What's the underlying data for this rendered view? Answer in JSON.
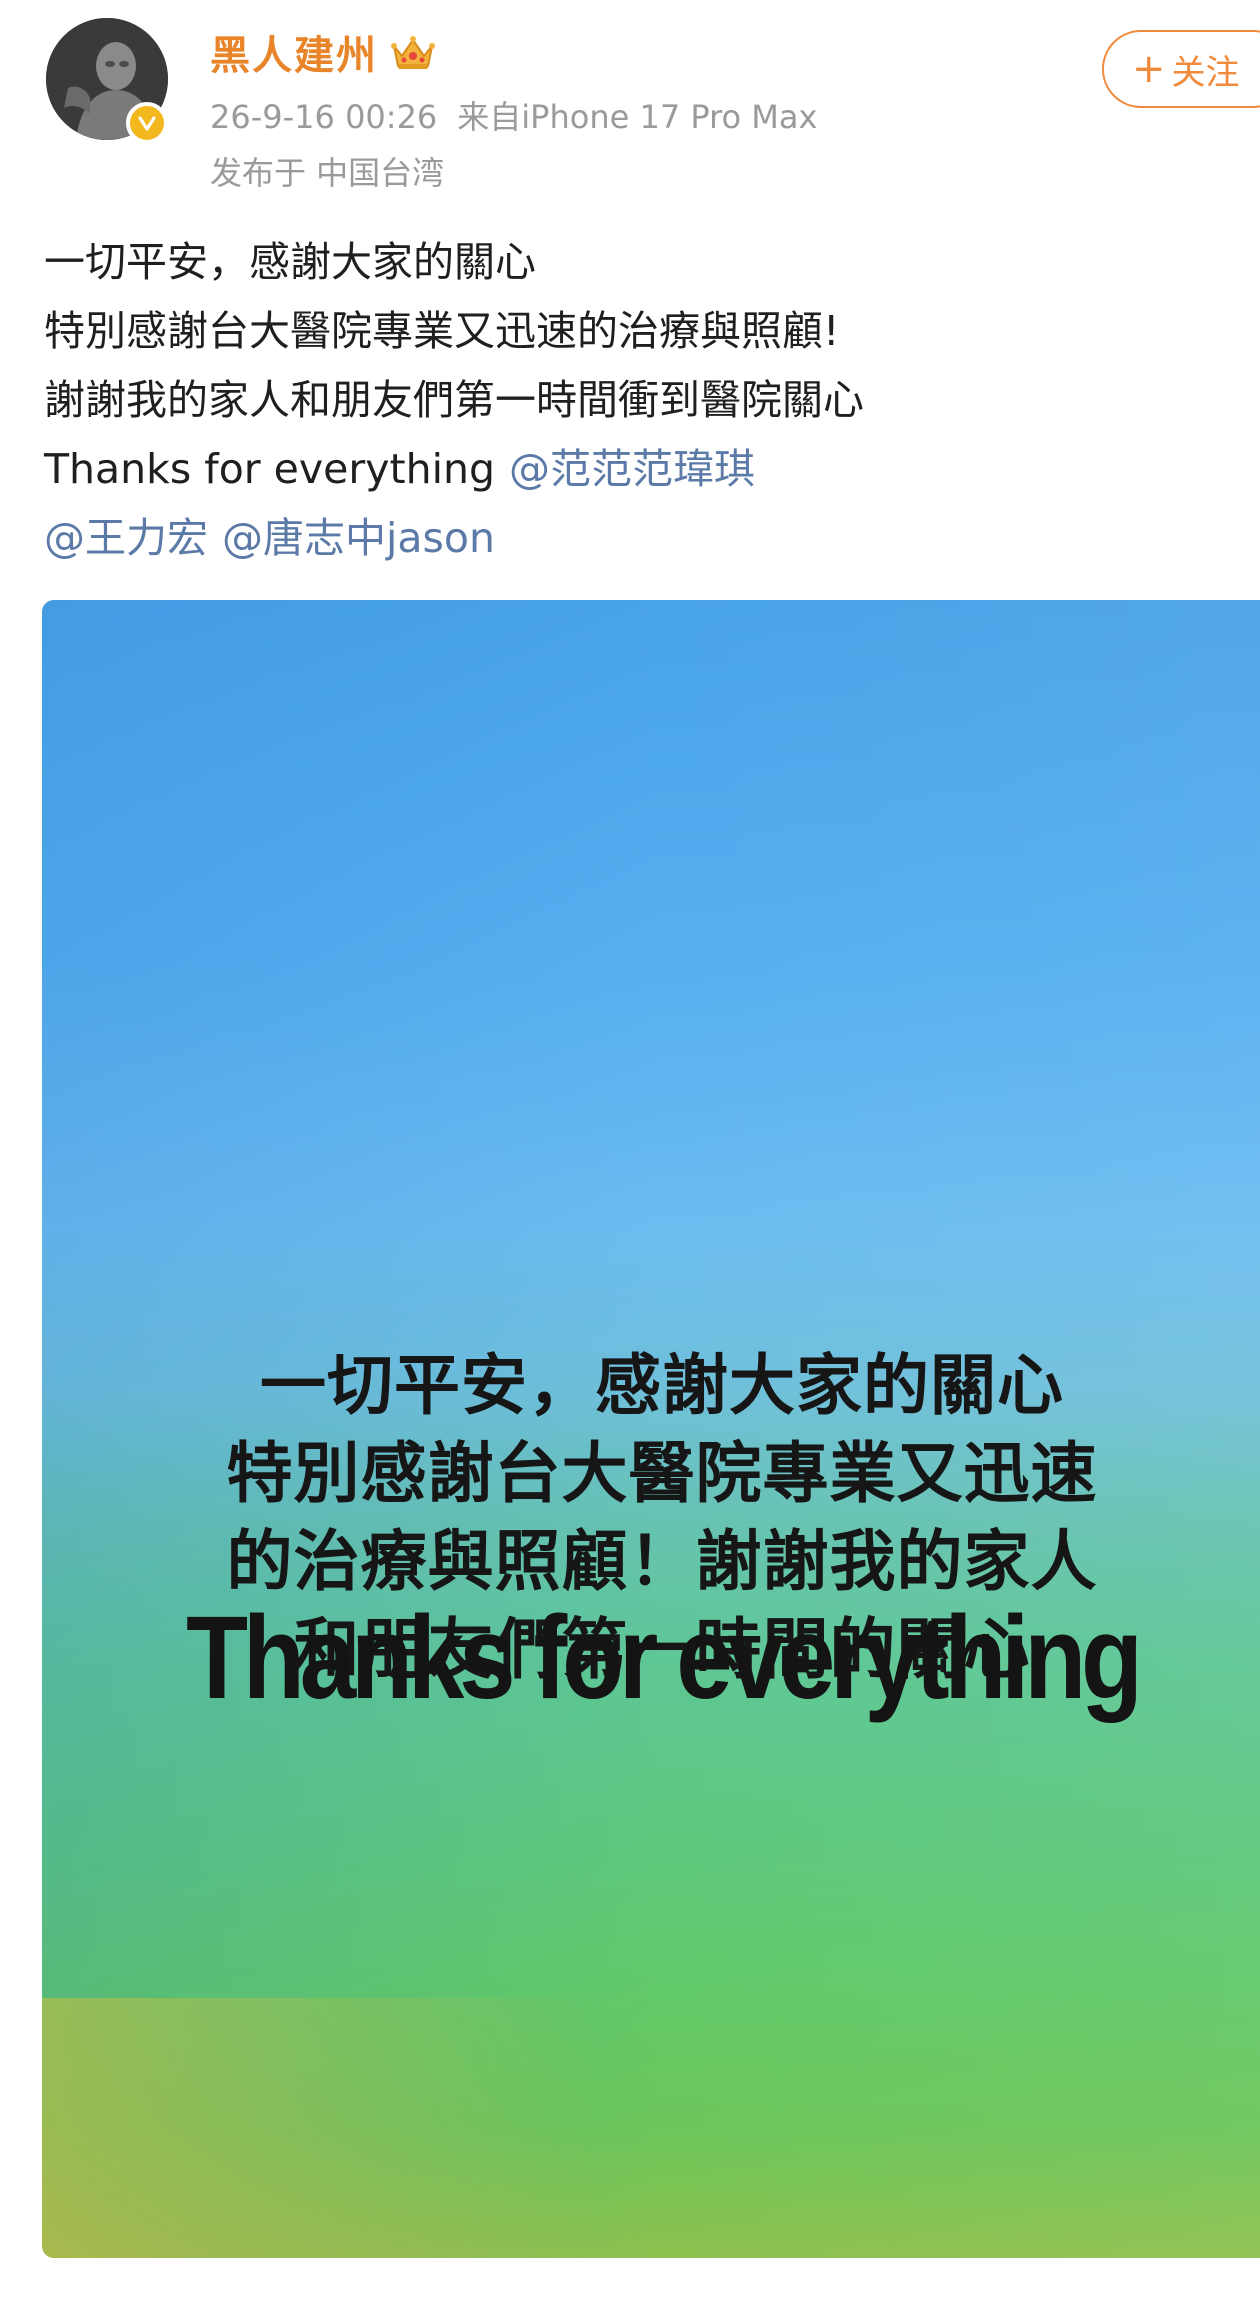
{
  "header": {
    "username": "黑人建州",
    "meta_time": "26-9-16 00:26",
    "meta_source": "来自iPhone 17 Pro Max",
    "meta_location": "发布于 中国台湾",
    "follow_plus": "+",
    "follow_label": "关注"
  },
  "post": {
    "lines": [
      "一切平安，感謝大家的關心",
      "特別感謝台大醫院專業又迅速的治療與照顧!",
      "謝謝我的家人和朋友們第一時間衝到醫院關心"
    ],
    "line4_text": "Thanks for everything",
    "mention1": "@范范范瑋琪",
    "mention2": "@王力宏",
    "mention3": "@唐志中jason"
  },
  "image": {
    "caption_lines": [
      "一切平安，感謝大家的關心",
      "特別感謝台大醫院專業又迅速",
      "的治療與照顧！謝謝我的家人",
      "和朋友們第一時間的關心"
    ],
    "thanks_text": "Thanks for everything"
  },
  "colors": {
    "username": "#e8852a",
    "mention": "#5c7aa8",
    "meta": "#9a9a9a",
    "follow": "#f08a3c",
    "badge": "#f4b81f"
  },
  "icons": {
    "avatar": "avatar-photo",
    "verified": "verified-badge-icon",
    "crown": "crown-icon",
    "plus": "plus-icon"
  }
}
